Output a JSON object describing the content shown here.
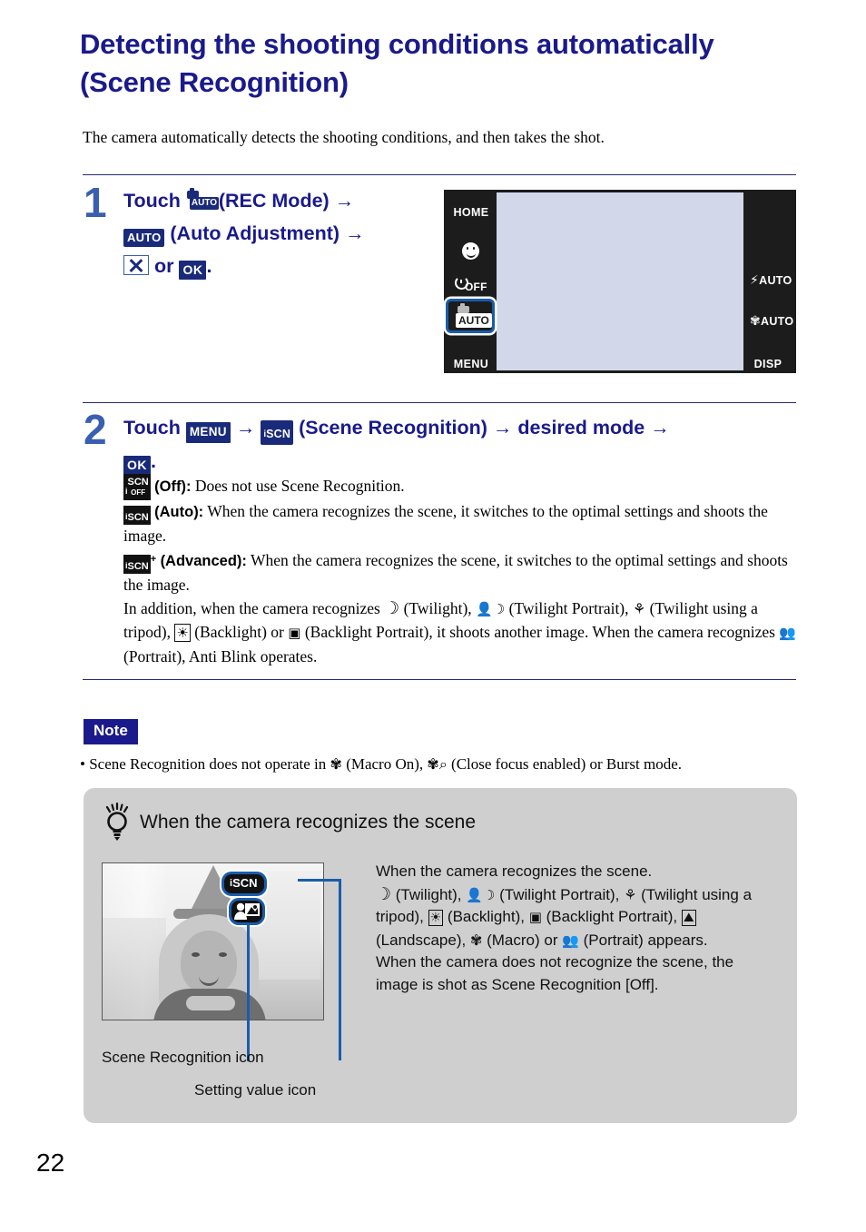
{
  "page": {
    "number": "22"
  },
  "title": "Detecting the shooting conditions automatically (Scene Recognition)",
  "intro": "The camera automatically detects the shooting conditions, and then takes the shot.",
  "steps": [
    {
      "number": "1",
      "prefix": "Touch",
      "icon1": "rec-mode-auto-icon",
      "label1": "(REC Mode)",
      "icon2_label": "AUTO",
      "label2": "(Auto Adjustment)",
      "icon3": "close-x-icon",
      "or": "or",
      "icon4_label": "OK",
      "period": "."
    },
    {
      "number": "2",
      "prefix": "Touch",
      "menu_label": "MENU",
      "iscn_i": "i",
      "iscn_scn": "SCN",
      "label1": "(Scene Recognition)",
      "label2": "desired mode",
      "ok_label": "OK",
      "period": "."
    }
  ],
  "arrow": "→",
  "lcd": {
    "home": "HOME",
    "menu": "MENU",
    "disp": "DISP",
    "smile": "smile-shutter-icon",
    "self_timer": "OFF",
    "rec_mode_auto": "AUTO",
    "flash": "AUTO",
    "macro": "AUTO"
  },
  "modes": {
    "off": {
      "icon_i": "i",
      "icon_scn": "SCN",
      "icon_off": "OFF",
      "name": "(Off):",
      "desc": " Does not use Scene Recognition."
    },
    "auto": {
      "icon_i": "i",
      "icon_scn": "SCN",
      "name": "(Auto):",
      "desc": " When the camera recognizes the scene, it switches to the optimal settings and shoots the image."
    },
    "advanced": {
      "icon_i": "i",
      "icon_scn": "SCN",
      "icon_plus": "+",
      "name": "(Advanced):",
      "desc": " When the camera recognizes the scene, it switches to the optimal settings and shoots the image."
    },
    "addition": {
      "t1": "In addition, when the camera recognizes ",
      "moon": "☽",
      "t2": " (Twilight), ",
      "twilight_portrait": "twilight-portrait-icon",
      "t3": " (Twilight Portrait), ",
      "tripod": "twilight-tripod-icon",
      "t4": " (Twilight using a tripod), ",
      "backlight": "backlight-icon",
      "t5": " (Backlight) or ",
      "backlight_portrait": "backlight-portrait-icon",
      "t6": " (Backlight Portrait), it shoots another image. When the camera recognizes ",
      "portrait": "portrait-icon",
      "t7": " (Portrait), Anti Blink operates."
    }
  },
  "note": {
    "badge": "Note",
    "bullet": "•",
    "text1": " Scene Recognition does not operate in ",
    "macro_icon": "macro-on-icon",
    "text2": " (Macro On), ",
    "close_focus_icon": "close-focus-icon",
    "text3": " (Close focus enabled) or Burst mode."
  },
  "tip": {
    "heading": "When the camera recognizes the scene",
    "bulb_icon": "lightbulb-icon",
    "callout_iscn_i": "i",
    "callout_iscn_scn": "SCN",
    "callout_setting_icon": "backlight-portrait-icon",
    "label_scene_recognition": "Scene Recognition icon",
    "label_setting_value": "Setting value icon",
    "body": {
      "l1": "When the camera recognizes the scene.",
      "moon": "☽",
      "l2a": " (Twilight), ",
      "twilight_portrait": "twilight-portrait-icon",
      "l2b": " (Twilight Portrait), ",
      "tripod": "twilight-tripod-icon",
      "l2c": " (Twilight using a tripod), ",
      "backlight": "backlight-icon",
      "l2d": " (Backlight), ",
      "backlight_portrait": "backlight-portrait-icon",
      "l2e": " (Backlight Portrait), ",
      "landscape": "landscape-icon",
      "l2f": " (Landscape), ",
      "macro": "macro-icon",
      "l2g": " (Macro) or ",
      "portrait": "portrait-icon",
      "l2h": " (Portrait) appears.",
      "l3": "When the camera does not recognize the scene, the image is shot as Scene Recognition [Off]."
    }
  },
  "colors": {
    "title_blue": "#1a1a8c",
    "step_blue": "#1a1a8c",
    "accent_blue": "#1a5cab",
    "tip_bg": "#cfcfcf",
    "lcd_black": "#1c1c1c",
    "lcd_screen": "#d2d8ea"
  }
}
